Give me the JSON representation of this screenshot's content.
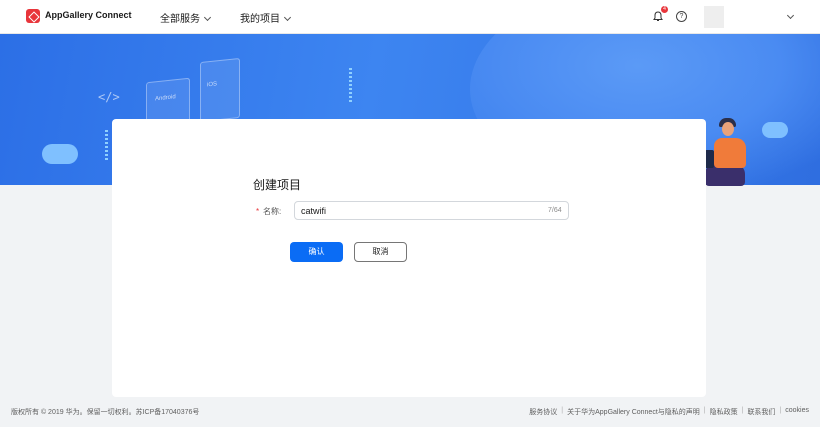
{
  "header": {
    "app_title": "AppGallery Connect",
    "nav": [
      {
        "label": "全部服务"
      },
      {
        "label": "我的项目"
      }
    ],
    "notification_count": "4",
    "help_glyph": "?"
  },
  "banner": {
    "tag_android": "Android",
    "tag_ios": "iOS",
    "code_glyph": "</>"
  },
  "form": {
    "title": "创建项目",
    "required_mark": "*",
    "name_label": "名称:",
    "name_value": "catwifi",
    "char_count": "7/64",
    "confirm_label": "确认",
    "cancel_label": "取消"
  },
  "footer": {
    "copyright": "版权所有 © 2019 华为。保留一切权利。苏ICP备17040376号",
    "links": [
      "服务协议",
      "关于华为AppGallery Connect与隐私的声明",
      "隐私政策",
      "联系我们",
      "cookies"
    ],
    "separator": "|"
  },
  "colors": {
    "primary": "#0a6cf5",
    "brand": "#e8353b",
    "banner": "#3d85f1"
  }
}
